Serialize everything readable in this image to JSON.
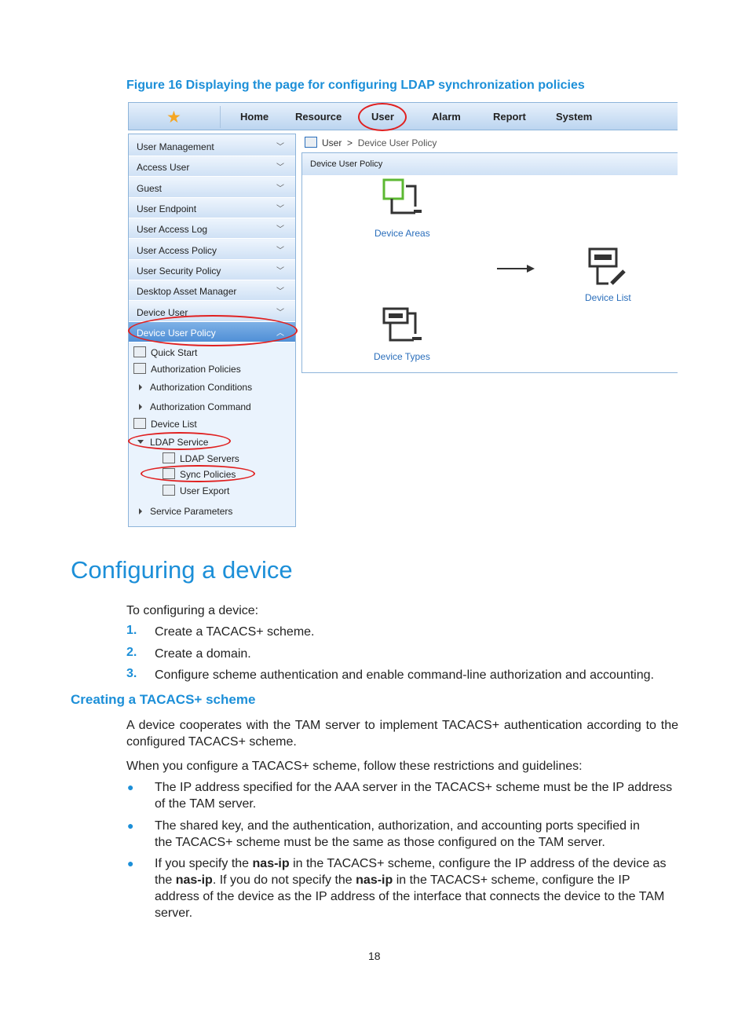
{
  "figure_caption": "Figure 16 Displaying the page for configuring LDAP synchronization policies",
  "nav": {
    "tabs": [
      "Home",
      "Resource",
      "User",
      "Alarm",
      "Report",
      "System"
    ]
  },
  "sidebar": {
    "items": [
      "User Management",
      "Access User",
      "Guest",
      "User Endpoint",
      "User Access Log",
      "User Access Policy",
      "User Security Policy",
      "Desktop Asset Manager",
      "Device User",
      "Device User Policy"
    ],
    "tree": [
      "Quick Start",
      "Authorization Policies",
      "Authorization Conditions",
      "Authorization Command",
      "Device List",
      "LDAP Service",
      "LDAP Servers",
      "Sync Policies",
      "User Export",
      "Service Parameters"
    ]
  },
  "breadcrumb": {
    "root": "User",
    "sep": ">",
    "current": "Device User Policy"
  },
  "panel": {
    "title": "Device User Policy",
    "items": [
      "Device Areas",
      "Device List",
      "Device Types"
    ]
  },
  "doc": {
    "heading": "Configuring a device",
    "intro": "To configuring a device:",
    "steps": [
      {
        "n": "1.",
        "text": "Create a TACACS+ scheme."
      },
      {
        "n": "2.",
        "text": "Create a domain."
      },
      {
        "n": "3.",
        "text": "Configure scheme authentication and enable command-line authorization and accounting."
      }
    ],
    "subheading": "Creating a TACACS+ scheme",
    "p1": "A device cooperates with the TAM server to implement TACACS+ authentication according to the configured TACACS+ scheme.",
    "p2": "When you configure a TACACS+ scheme, follow these restrictions and guidelines:",
    "b1": "The IP address specified for the AAA server in the TACACS+ scheme must be the IP address of the TAM server.",
    "b2": "The shared key, and the authentication, authorization, and accounting ports specified in the TACACS+ scheme must be the same as those configured on the TAM server.",
    "b3": {
      "a": "If you specify the ",
      "k1": "nas-ip",
      "b": " in the TACACS+ scheme, configure the IP address of the device as the ",
      "k2": "nas-ip",
      "c": ". If you do not specify the ",
      "k3": "nas-ip",
      "d": " in the TACACS+ scheme, configure the IP address of the device as the IP address of the interface that connects the device to the TAM server."
    },
    "page_number": "18"
  }
}
